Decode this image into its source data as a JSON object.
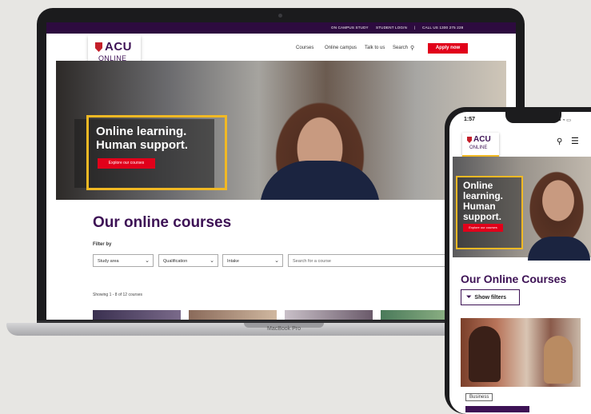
{
  "laptop": {
    "brand_label": "MacBook Pro",
    "site": {
      "topbar": {
        "on_campus": "ON CAMPUS STUDY",
        "student_login": "STUDENT LOGIN",
        "divider": "|",
        "call_us": "CALL US  1300 275 228"
      },
      "logo": {
        "main": "ACU",
        "sub": "ONLINE"
      },
      "nav": {
        "courses": "Courses",
        "online_campus": "Online campus",
        "talk_to_us": "Talk to us",
        "search": "Search",
        "apply": "Apply now"
      },
      "hero": {
        "title_line1": "Online learning.",
        "title_line2": "Human support.",
        "button": "Explore our courses"
      },
      "courses": {
        "title": "Our online courses",
        "filter_label": "Filter by",
        "filters": {
          "study_area": "Study area",
          "qualification": "Qualification",
          "intake": "Intake",
          "search_placeholder": "Search for a course"
        },
        "showing": "Showing 1 - 8 of 12 courses"
      }
    }
  },
  "phone": {
    "time": "1:57",
    "status_icons": "▪▪ ◔ ▭",
    "logo": {
      "main": "ACU",
      "sub": "ONLINE"
    },
    "hero": {
      "title_line1": "Online",
      "title_line2": "learning.",
      "title_line3": "Human",
      "title_line4": "support.",
      "button": "Explore our courses"
    },
    "courses": {
      "title": "Our Online Courses",
      "filter_button": "Show filters",
      "card_tag": "Business"
    }
  },
  "colors": {
    "brand_purple": "#3d1255",
    "accent_yellow": "#f1b924",
    "cta_red": "#e1001a",
    "topbar": "#2d0b3f"
  }
}
